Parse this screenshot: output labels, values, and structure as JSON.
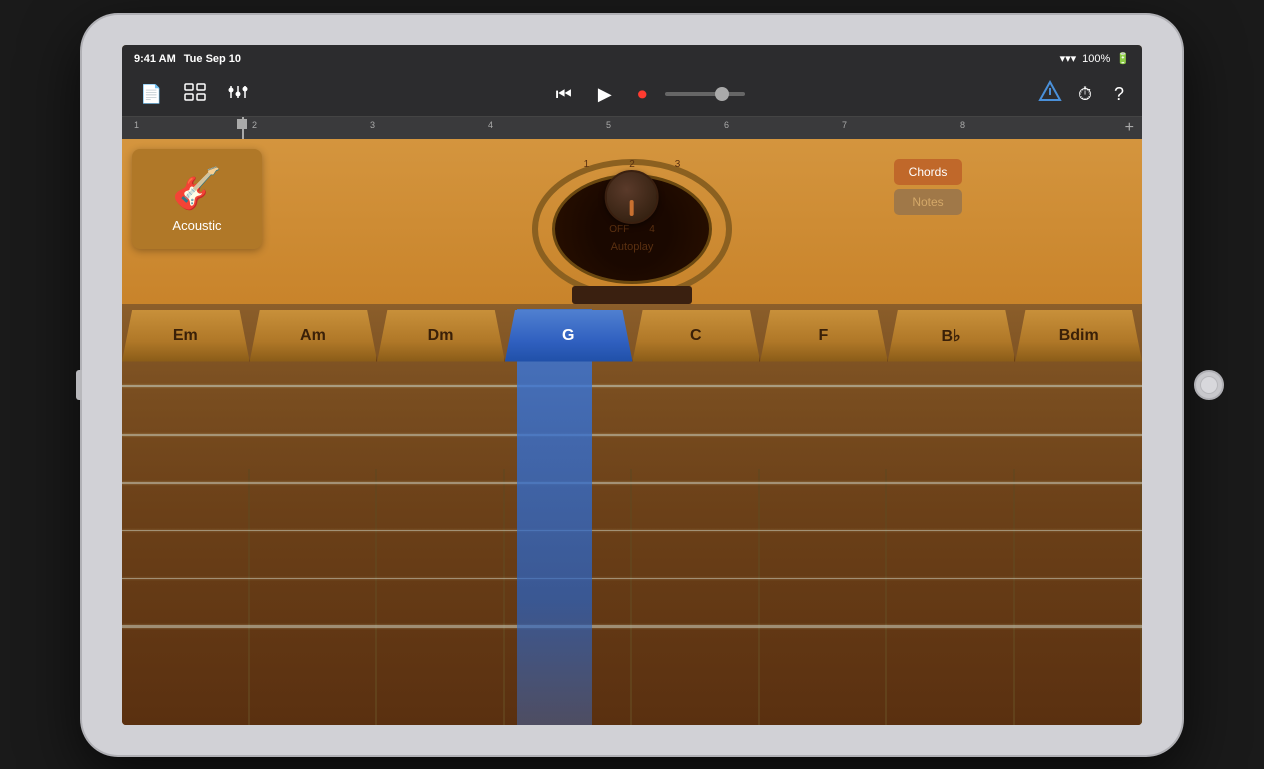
{
  "status_bar": {
    "time": "9:41 AM",
    "date": "Tue Sep 10",
    "wifi": "WiFi",
    "battery": "100%"
  },
  "toolbar": {
    "new_song_label": "📄",
    "tracks_label": "⊞",
    "mixer_label": "⚙",
    "rewind_label": "⏮",
    "play_label": "▶",
    "record_label": "⏺",
    "smart_tempo_label": "△",
    "settings_label": "⏱",
    "help_label": "?"
  },
  "instrument": {
    "name": "Acoustic",
    "icon": "🎸"
  },
  "autoplay": {
    "label": "Autoplay",
    "positions": [
      "OFF",
      "1",
      "2",
      "3",
      "4"
    ]
  },
  "mode_toggle": {
    "chords_label": "Chords",
    "notes_label": "Notes"
  },
  "chords": [
    {
      "label": "Em",
      "active": false
    },
    {
      "label": "Am",
      "active": false
    },
    {
      "label": "Dm",
      "active": false
    },
    {
      "label": "G",
      "active": true
    },
    {
      "label": "C",
      "active": false
    },
    {
      "label": "F",
      "active": false
    },
    {
      "label": "B♭",
      "active": false
    },
    {
      "label": "Bdim",
      "active": false
    }
  ],
  "timeline": {
    "markers": [
      "1",
      "2",
      "3",
      "4",
      "5",
      "6",
      "7",
      "8"
    ]
  },
  "strings": [
    1,
    2,
    3,
    4,
    5,
    6
  ]
}
